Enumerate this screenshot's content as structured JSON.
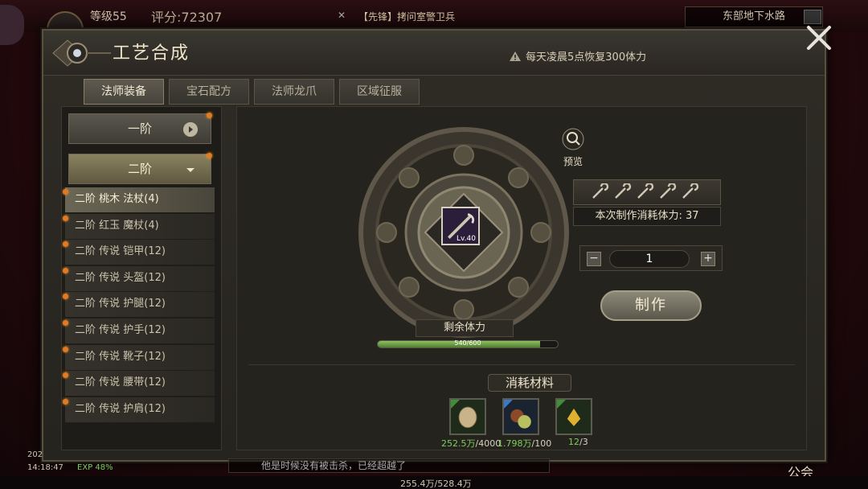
{
  "hud": {
    "level": "等级55",
    "score": "评分:72307",
    "quest": "【先锋】拷问室警卫兵",
    "location": "东部地下水路",
    "time": "14:18:47",
    "exp": "EXP 48%",
    "date_partial": "202",
    "chat_partial": "他是时候没有被击杀，已经超越了",
    "bottom_stat": "255.4万/528.4万",
    "guild": "公会"
  },
  "panel": {
    "title": "工艺合成",
    "notice": "每天凌晨5点恢复300体力",
    "tabs": [
      {
        "label": "法师装备",
        "active": true
      },
      {
        "label": "宝石配方",
        "active": false
      },
      {
        "label": "法师龙爪",
        "active": false
      },
      {
        "label": "区域征服",
        "active": false
      }
    ]
  },
  "tiers": {
    "tier1": "一阶",
    "tier2": "二阶"
  },
  "recipes": [
    {
      "label": "二阶 桃木 法杖(4)",
      "selected": true
    },
    {
      "label": "二阶 红玉 魔杖(4)",
      "selected": false
    },
    {
      "label": "二阶 传说 铠甲(12)",
      "selected": false
    },
    {
      "label": "二阶 传说 头盔(12)",
      "selected": false
    },
    {
      "label": "二阶 传说 护腿(12)",
      "selected": false
    },
    {
      "label": "二阶 传说 护手(12)",
      "selected": false
    },
    {
      "label": "二阶 传说 靴子(12)",
      "selected": false
    },
    {
      "label": "二阶 传说 腰带(12)",
      "selected": false
    },
    {
      "label": "二阶 传说 护肩(12)",
      "selected": false
    }
  ],
  "craft": {
    "item_level": "Lv.40",
    "preview_label": "预览",
    "cost_text": "本次制作消耗体力: 37",
    "quantity": "1",
    "make_label": "制作",
    "stamina_label": "剩余体力",
    "stamina_text": "540/600",
    "stamina_fraction": 0.9,
    "materials_title": "消耗材料",
    "materials": [
      {
        "icon": "gold-coin-icon",
        "have": "252.5万",
        "need": "/4000",
        "color": "#c9b48a"
      },
      {
        "icon": "ore-pile-icon",
        "have": "1.798万",
        "need": "/100",
        "color": "#8a5a3a"
      },
      {
        "icon": "gold-crystal-icon",
        "have": "12",
        "need": "/3",
        "color": "#e0b030"
      }
    ]
  },
  "colors": {
    "accent_green": "#7bcf5a",
    "notification_dot": "#e07a2a"
  }
}
